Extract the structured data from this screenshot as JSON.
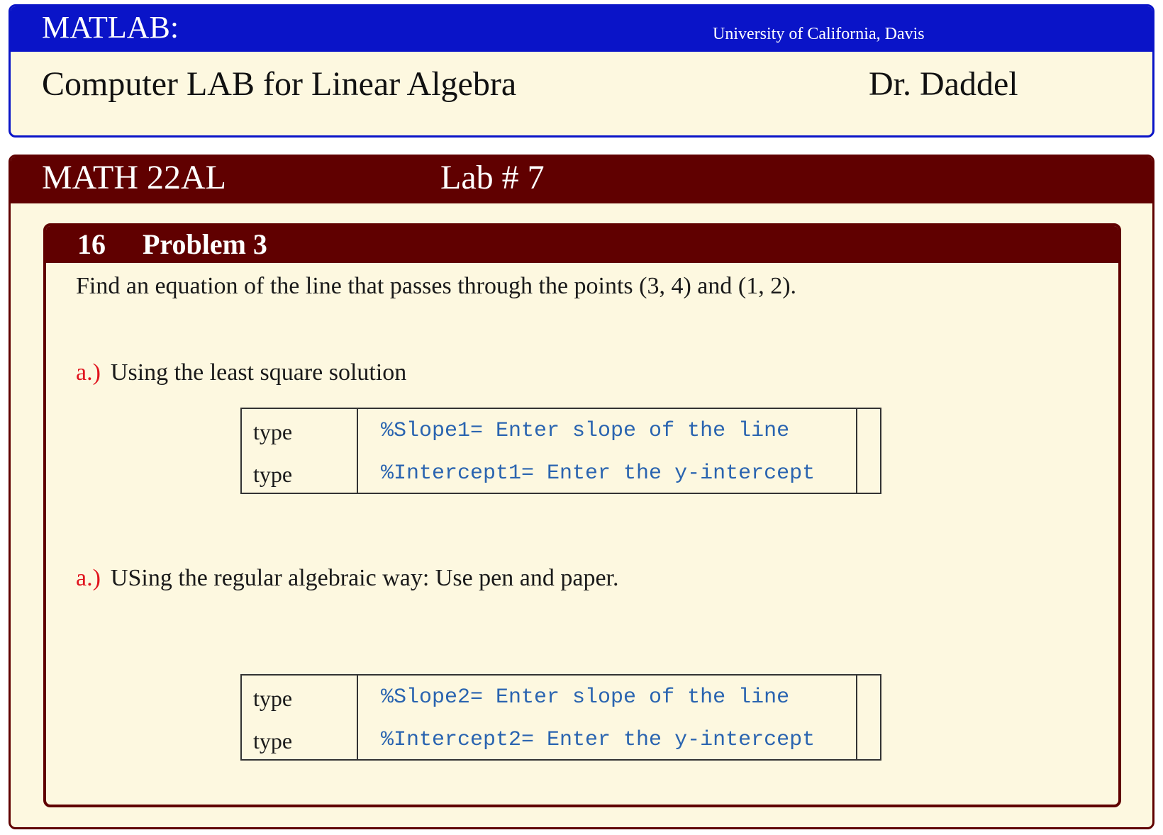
{
  "header": {
    "title": "MATLAB:",
    "institution": "University of California, Davis",
    "subtitle": "Computer LAB for Linear Algebra",
    "author": "Dr. Daddel",
    "colors": {
      "bar": "#0a14c8",
      "panel": "#fdf8e0"
    }
  },
  "course_panel": {
    "course": "MATH 22AL",
    "lab": "Lab # 7",
    "colors": {
      "bar": "#600000"
    }
  },
  "problem": {
    "number": "16",
    "title": "Problem 3",
    "statement": "Find an equation of the line that passes through the points (3, 4) and (1, 2).",
    "parts": [
      {
        "label": "a.)",
        "text": "Using the least square solution",
        "rows": [
          {
            "key": "type",
            "value": "%Slope1= Enter slope of the line"
          },
          {
            "key": "type",
            "value": "%Intercept1= Enter the y-intercept"
          }
        ]
      },
      {
        "label": "a.)",
        "text": "USing the regular algebraic way: Use pen and paper.",
        "rows": [
          {
            "key": "type",
            "value": "%Slope2= Enter slope of the line"
          },
          {
            "key": "type",
            "value": "%Intercept2= Enter the y-intercept"
          }
        ]
      }
    ],
    "colors": {
      "part_label": "#e0141e",
      "code": "#2a64b0"
    }
  }
}
